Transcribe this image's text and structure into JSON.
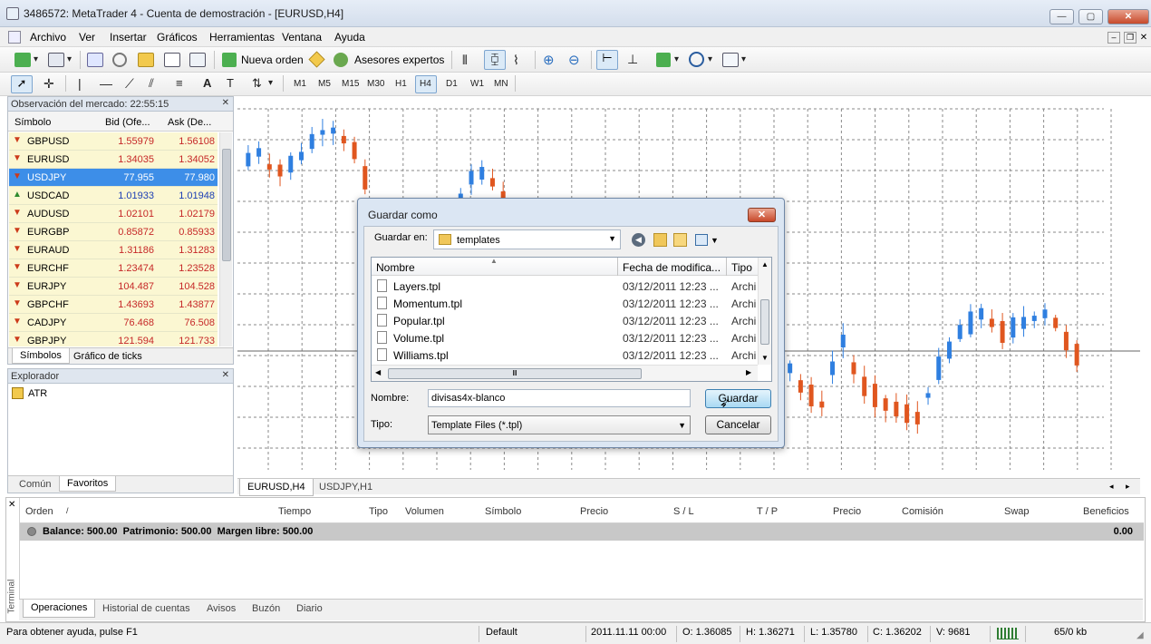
{
  "window": {
    "title": "3486572: MetaTrader 4 - Cuenta de demostración - [EURUSD,H4]"
  },
  "menu": [
    "Archivo",
    "Ver",
    "Insertar",
    "Gráficos",
    "Herramientas",
    "Ventana",
    "Ayuda"
  ],
  "toolbar": {
    "new_order": "Nueva orden",
    "expert_advisors": "Asesores expertos",
    "timeframes": [
      "M1",
      "M5",
      "M15",
      "M30",
      "H1",
      "H4",
      "D1",
      "W1",
      "MN"
    ],
    "active_timeframe": "H4"
  },
  "market_watch": {
    "title": "Observación del mercado: 22:55:15",
    "col_symbol": "Símbolo",
    "col_bid": "Bid (Ofe...",
    "col_ask": "Ask (De...",
    "rows": [
      {
        "symbol": "GBPUSD",
        "bid": "1.55979",
        "ask": "1.56108",
        "dir": "down"
      },
      {
        "symbol": "EURUSD",
        "bid": "1.34035",
        "ask": "1.34052",
        "dir": "down"
      },
      {
        "symbol": "USDJPY",
        "bid": "77.955",
        "ask": "77.980",
        "dir": "down"
      },
      {
        "symbol": "USDCAD",
        "bid": "1.01933",
        "ask": "1.01948",
        "dir": "up"
      },
      {
        "symbol": "AUDUSD",
        "bid": "1.02101",
        "ask": "1.02179",
        "dir": "down"
      },
      {
        "symbol": "EURGBP",
        "bid": "0.85872",
        "ask": "0.85933",
        "dir": "down"
      },
      {
        "symbol": "EURAUD",
        "bid": "1.31186",
        "ask": "1.31283",
        "dir": "down"
      },
      {
        "symbol": "EURCHF",
        "bid": "1.23474",
        "ask": "1.23528",
        "dir": "down"
      },
      {
        "symbol": "EURJPY",
        "bid": "104.487",
        "ask": "104.528",
        "dir": "down"
      },
      {
        "symbol": "GBPCHF",
        "bid": "1.43693",
        "ask": "1.43877",
        "dir": "down"
      },
      {
        "symbol": "CADJPY",
        "bid": "76.468",
        "ask": "76.508",
        "dir": "down"
      },
      {
        "symbol": "GBPJPY",
        "bid": "121.594",
        "ask": "121.733",
        "dir": "down"
      }
    ],
    "selected_row": 2,
    "tabs": [
      "Símbolos",
      "Gráfico de ticks"
    ]
  },
  "navigator": {
    "title": "Explorador",
    "item": "ATR",
    "tabs": [
      "Común",
      "Favoritos"
    ]
  },
  "chart_tabs": [
    "EURUSD,H4",
    "USDJPY,H1"
  ],
  "dialog": {
    "title": "Guardar como",
    "save_in_label": "Guardar en:",
    "folder": "templates",
    "col_name": "Nombre",
    "col_date": "Fecha de modifica...",
    "col_type": "Tipo",
    "files": [
      {
        "name": "Layers.tpl",
        "date": "03/12/2011 12:23 ...",
        "type": "Archi"
      },
      {
        "name": "Momentum.tpl",
        "date": "03/12/2011 12:23 ...",
        "type": "Archi"
      },
      {
        "name": "Popular.tpl",
        "date": "03/12/2011 12:23 ...",
        "type": "Archi"
      },
      {
        "name": "Volume.tpl",
        "date": "03/12/2011 12:23 ...",
        "type": "Archi"
      },
      {
        "name": "Williams.tpl",
        "date": "03/12/2011 12:23 ...",
        "type": "Archi"
      }
    ],
    "filename_label": "Nombre:",
    "filename_value": "divisas4x-blanco",
    "type_label": "Tipo:",
    "type_value": "Template Files (*.tpl)",
    "save_button": "Guardar",
    "cancel_button": "Cancelar"
  },
  "terminal": {
    "vertical_label": "Terminal",
    "columns": [
      "Orden",
      "/",
      "Tiempo",
      "Tipo",
      "Volumen",
      "Símbolo",
      "Precio",
      "S / L",
      "T / P",
      "Precio",
      "Comisión",
      "Swap",
      "Beneficios"
    ],
    "balance_text": "Balance: 500.00  Patrimonio: 500.00  Margen libre: 500.00",
    "balance_profit": "0.00",
    "tabs": [
      "Operaciones",
      "Historial de cuentas",
      "Avisos",
      "Buzón",
      "Diario"
    ]
  },
  "status": {
    "help": "Para obtener ayuda, pulse F1",
    "profile": "Default",
    "time": "2011.11.11 00:00",
    "open": "O: 1.36085",
    "high": "H: 1.36271",
    "low": "L: 1.35780",
    "close": "C: 1.36202",
    "volume": "V: 9681",
    "traffic": "65/0 kb"
  },
  "colors": {
    "bull": "#2f7fe0",
    "bear": "#e0561f",
    "grid": "#8a8a8a",
    "market_row_bg": "#fbf7d2",
    "selected_row_bg": "#3d8ee8"
  }
}
